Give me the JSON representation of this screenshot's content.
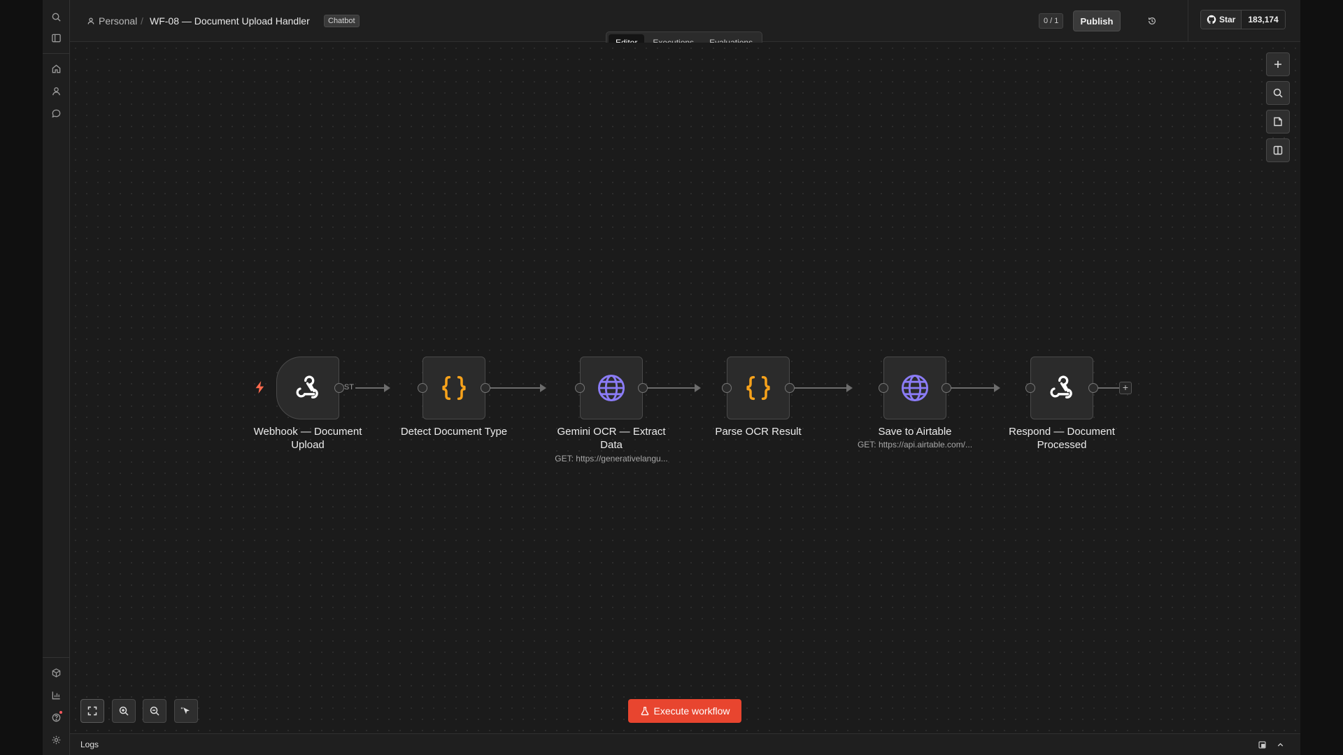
{
  "header": {
    "breadcrumb_project": "Personal",
    "breadcrumb_sep": "/",
    "workflow_title": "WF-08 — Document Upload Handler",
    "tag": "Chatbot",
    "counter": "0 / 1",
    "publish_label": "Publish",
    "github_star_label": "Star",
    "github_star_count": "183,174"
  },
  "tabs": [
    {
      "label": "Editor",
      "active": true
    },
    {
      "label": "Executions",
      "active": false
    },
    {
      "label": "Evaluations",
      "active": false
    }
  ],
  "nodes": [
    {
      "title": "Webhook — Document Upload",
      "subtitle": "",
      "icon": "webhook-icon",
      "icon_color": "#ffffff"
    },
    {
      "title": "Detect Document Type",
      "subtitle": "",
      "icon": "code-braces-icon",
      "icon_color": "#f7a21b"
    },
    {
      "title": "Gemini OCR — Extract Data",
      "subtitle": "GET: https://generativelangu...",
      "icon": "globe-icon",
      "icon_color": "#8b7cf6"
    },
    {
      "title": "Parse OCR Result",
      "subtitle": "",
      "icon": "code-braces-icon",
      "icon_color": "#f7a21b"
    },
    {
      "title": "Save to Airtable",
      "subtitle": "GET: https://api.airtable.com/...",
      "icon": "globe-icon",
      "icon_color": "#8b7cf6"
    },
    {
      "title": "Respond — Document Processed",
      "subtitle": "",
      "icon": "webhook-icon",
      "icon_color": "#ffffff"
    }
  ],
  "connection_labels": {
    "webhook_method": "POST"
  },
  "execute_label": "Execute workflow",
  "logs_label": "Logs",
  "colors": {
    "accent": "#e8452f",
    "trigger_bolt": "#ff6a4d"
  }
}
